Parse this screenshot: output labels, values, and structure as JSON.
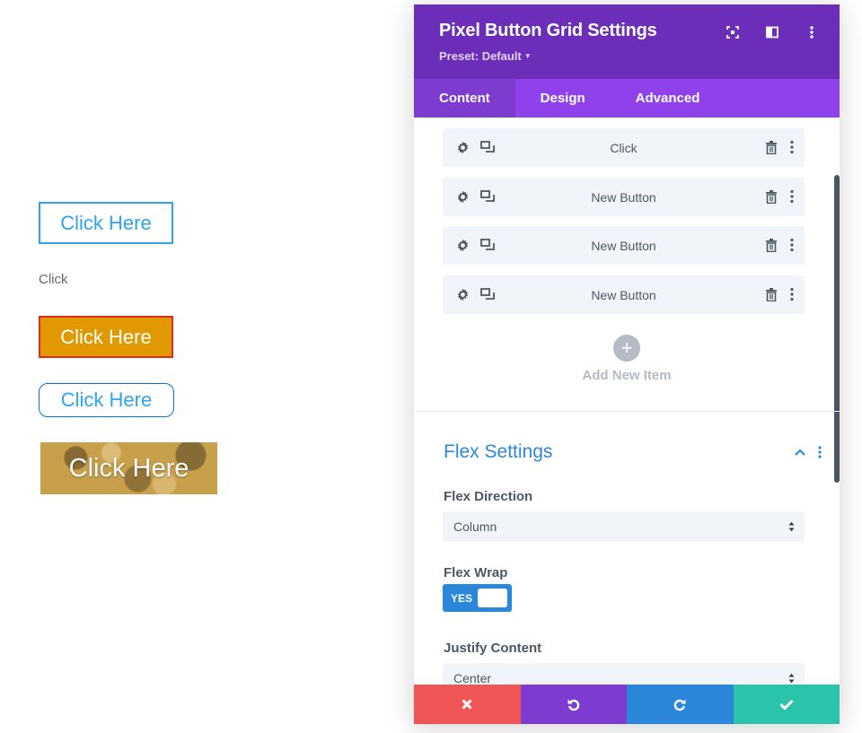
{
  "preview": {
    "button_outline_label": "Click Here",
    "text_label": "Click",
    "button_orange_label": "Click Here",
    "button_rounded_label": "Click Here",
    "button_image_label": "Click Here"
  },
  "panel": {
    "title": "Pixel Button Grid Settings",
    "preset": "Preset: Default",
    "header_icons": [
      "fullscreen-icon",
      "split-view-icon",
      "more-vertical-icon"
    ],
    "tabs": [
      {
        "label": "Content",
        "active": true
      },
      {
        "label": "Design",
        "active": false
      },
      {
        "label": "Advanced",
        "active": false
      }
    ],
    "items": [
      {
        "label": "Click"
      },
      {
        "label": "New Button"
      },
      {
        "label": "New Button"
      },
      {
        "label": "New Button"
      }
    ],
    "add_item_label": "Add New Item",
    "section": {
      "title": "Flex Settings",
      "fields": {
        "flex_direction": {
          "label": "Flex Direction",
          "value": "Column"
        },
        "flex_wrap": {
          "label": "Flex Wrap",
          "value": "YES"
        },
        "justify_content": {
          "label": "Justify Content",
          "value": "Center"
        }
      }
    },
    "footer": [
      "discard-icon",
      "undo-icon",
      "redo-icon",
      "save-icon"
    ]
  },
  "colors": {
    "header": "#6c2eb9",
    "tabs": "#8f42ec",
    "accent_blue": "#2b87da",
    "discard": "#ef5555",
    "undo": "#7e3bd0",
    "save": "#29c4a9",
    "orange_button": "#e09900"
  }
}
